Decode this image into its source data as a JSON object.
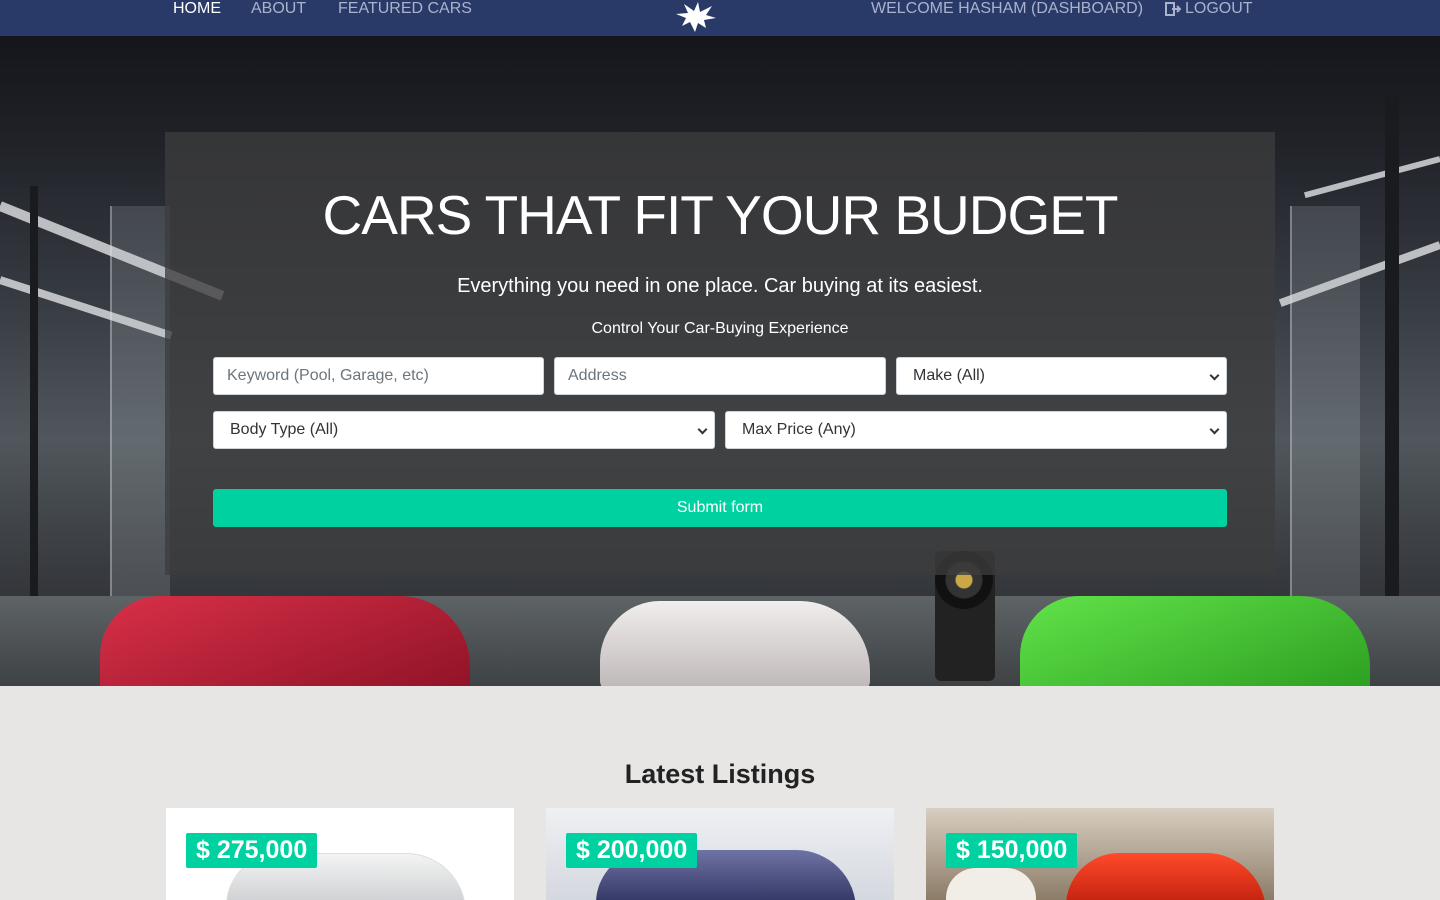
{
  "nav": {
    "home": "HOME",
    "about": "ABOUT",
    "featured": "FEATURED CARS",
    "welcome": "WELCOME HASHAM (DASHBOARD)",
    "logout": "LOGOUT"
  },
  "hero": {
    "title": "CARS THAT FIT YOUR BUDGET",
    "subtitle": "Everything you need in one place. Car buying at its easiest.",
    "tagline": "Control Your Car-Buying Experience"
  },
  "form": {
    "keyword_placeholder": "Keyword (Pool, Garage, etc)",
    "address_placeholder": "Address",
    "make_selected": "Make (All)",
    "body_selected": "Body Type (All)",
    "price_selected": "Max Price (Any)",
    "submit_label": "Submit form"
  },
  "listings": {
    "title": "Latest Listings",
    "cards": [
      {
        "price": "$ 275,000"
      },
      {
        "price": "$ 200,000"
      },
      {
        "price": "$ 150,000"
      }
    ]
  },
  "colors": {
    "navbar": "#2a3a68",
    "accent": "#00d1a1",
    "page_bg": "#e7e6e4"
  }
}
